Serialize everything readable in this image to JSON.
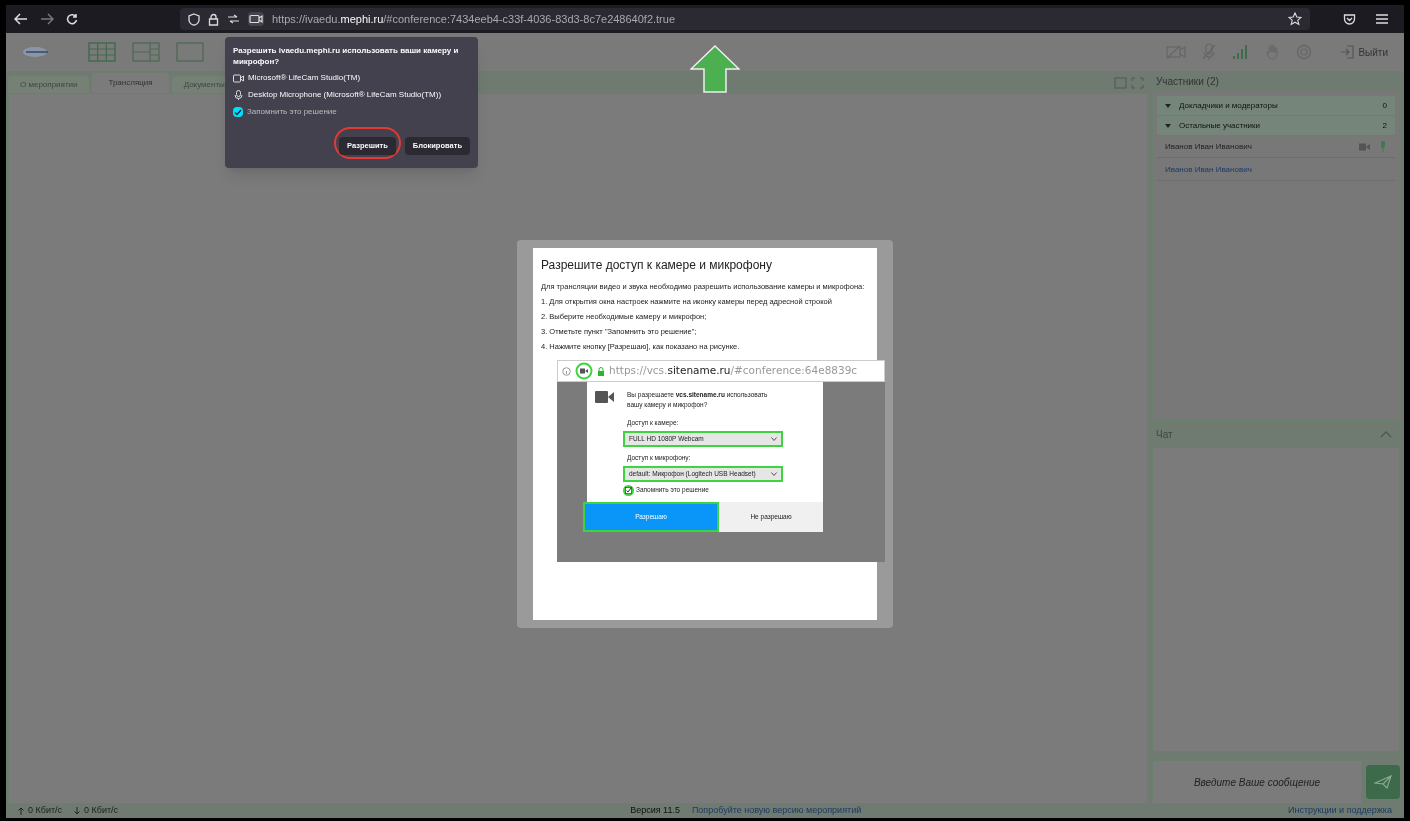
{
  "browser": {
    "url": "https://ivaedu.**mephi.ru**/#conference:7434eeb4-c33f-4036-83d3-8c7e248640f2.true"
  },
  "permission_popup": {
    "question": "Разрешить ivaedu.mephi.ru использовать ваши камеру и микрофон?",
    "devices": [
      {
        "kind": "camera",
        "label": "Microsoft® LifeCam Studio(TM)"
      },
      {
        "kind": "microphone",
        "label": "Desktop Microphone (Microsoft® LifeCam Studio(TM))"
      }
    ],
    "remember": {
      "label": "Запомнить это решение",
      "checked": true
    },
    "buttons": [
      {
        "label": "Разрешить",
        "highlighted": true
      },
      {
        "label": "Блокировать",
        "highlighted": false
      }
    ]
  },
  "app": {
    "exit_label": "Выйти",
    "tabs": [
      {
        "label": "О мероприятии",
        "selected": false
      },
      {
        "label": "Трансляция",
        "selected": true
      },
      {
        "label": "Документы",
        "selected": false
      }
    ],
    "participants": {
      "title": "Участники (2)",
      "groups": [
        {
          "label": "Докладчики и модераторы",
          "count": "0",
          "expanded": true
        },
        {
          "label": "Остальные участники",
          "count": "2",
          "expanded": true
        }
      ],
      "members": [
        {
          "name": "Иванов Иван Иванович",
          "kind": "media"
        },
        {
          "name": "Иванов Иван Иванович",
          "kind": "link"
        }
      ]
    },
    "chat": {
      "title": "Чат",
      "placeholder": "Введите Ваше сообщение"
    },
    "footer": {
      "upload": "0 Кбит/с",
      "download": "0 Кбит/с",
      "version": "Версия 11.5",
      "new_version_link": "Попробуйте новую версию мероприятий",
      "help_link": "Инструкции и поддержка"
    }
  },
  "modal": {
    "title": "Разрешите доступ к камере и микрофону",
    "intro": "Для трансляции видео и звука необходимо разрешить использование камеры и микрофона:",
    "steps": [
      "1. Для открытия окна настроек нажмите на иконку камеры перед адресной строкой",
      "2. Выберите необходимые камеру и микрофон;",
      "3. Отметьте пункт \"Запомнить это решение\";",
      "4. Нажмите кнопку [Разрешаю], как показано на рисунке."
    ],
    "illustration": {
      "url": "https://vcs.**sitename.ru**/#conference:64e8839c",
      "prompt": "Вы разрешаете **vcs.sitename.ru** использовать вашу камеру и микрофон?",
      "camera_label": "Доступ к камере:",
      "camera_value": "FULL HD 1080P Webcam",
      "mic_label": "Доступ к микрофону:",
      "mic_value": "default: Микрофон (Logitech USB Headset)",
      "remember": {
        "label": "Запомнить это решение",
        "checked": true
      },
      "allow": "Разрешаю",
      "deny": "Не разрешаю"
    }
  }
}
